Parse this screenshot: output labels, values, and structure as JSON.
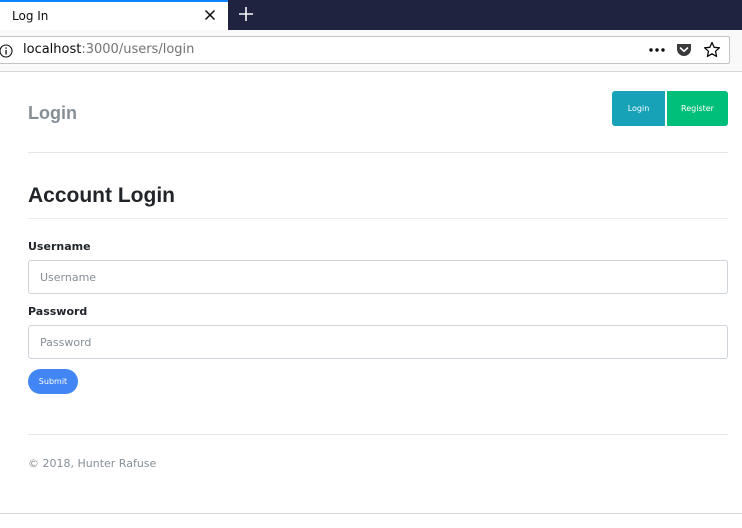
{
  "browser": {
    "tab_title": "Log In",
    "url_host": "localhost",
    "url_rest": ":3000/users/login",
    "page_actions_glyph": "•••",
    "icons": [
      "close-icon",
      "plus-icon",
      "info-icon",
      "more-icon",
      "pocket-icon",
      "star-icon"
    ]
  },
  "nav": {
    "brand": "Login",
    "login_button": "Login",
    "register_button": "Register"
  },
  "form": {
    "heading": "Account Login",
    "username_label": "Username",
    "username_placeholder": "Username",
    "username_value": "",
    "password_label": "Password",
    "password_placeholder": "Password",
    "password_value": "",
    "submit_label": "Submit"
  },
  "footer": {
    "text": "© 2018, Hunter Rafuse"
  },
  "colors": {
    "tab_bar": "#1f2340",
    "brand_muted": "#868e96",
    "login_button": "#17a2b8",
    "register_button": "#00bf7a",
    "submit_button": "#4285f4"
  }
}
